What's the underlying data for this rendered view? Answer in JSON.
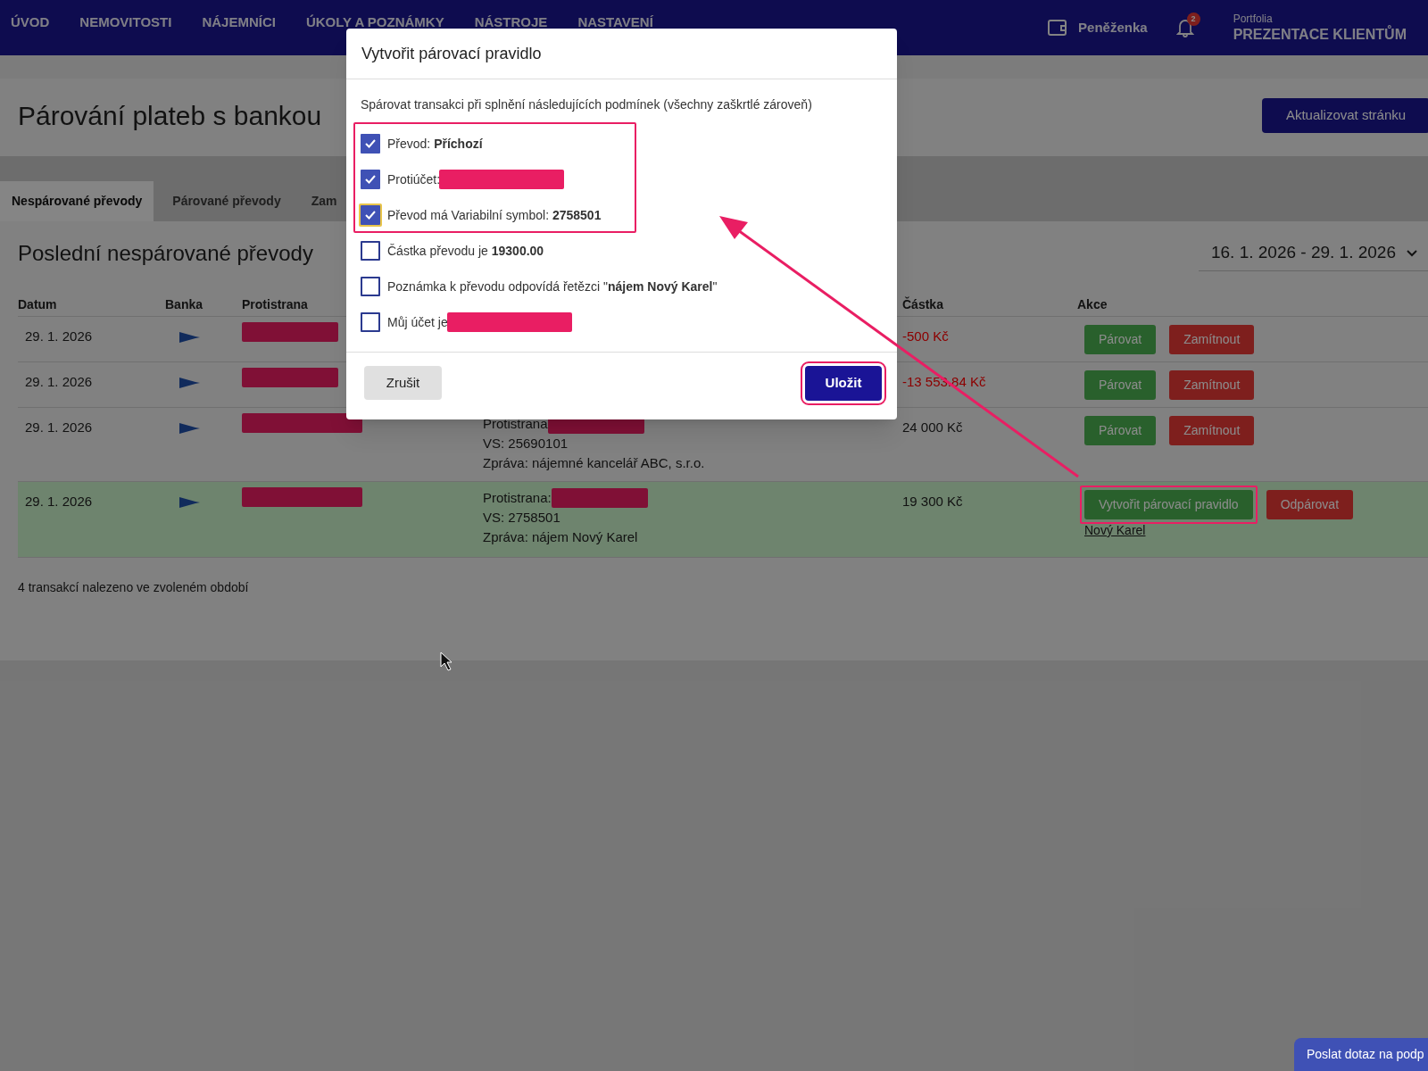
{
  "nav": {
    "items": [
      "ÚVOD",
      "NEMOVITOSTI",
      "NÁJEMNÍCI",
      "ÚKOLY A POZNÁMKY",
      "NÁSTROJE",
      "NASTAVENÍ"
    ],
    "wallet": "Peněženka",
    "notification_count": "2",
    "portfolio_label": "Portfolia",
    "portfolio_name": "PREZENTACE KLIENTŮM"
  },
  "page": {
    "title": "Párování plateb s bankou",
    "refresh_button": "Aktualizovat stránku"
  },
  "tabs": [
    {
      "label": "Nespárované převody",
      "selected": true
    },
    {
      "label": "Párované převody",
      "selected": false
    },
    {
      "label": "Zam",
      "selected": false
    }
  ],
  "section": {
    "title": "Poslední nespárované převody",
    "date_range": "16. 1. 2026 - 29. 1. 2026"
  },
  "table": {
    "columns": [
      "Datum",
      "Banka",
      "Protistrana",
      "Částka",
      "Akce"
    ],
    "rows": [
      {
        "date": "29. 1. 2026",
        "counterparty_redacted": true,
        "amount": "-500 Kč",
        "negative": true,
        "paired": false,
        "actions": [
          {
            "label": "Párovat",
            "kind": "pair"
          },
          {
            "label": "Zamítnout",
            "kind": "reject"
          }
        ]
      },
      {
        "date": "29. 1. 2026",
        "counterparty_redacted": true,
        "amount": "-13 553.84 Kč",
        "negative": true,
        "paired": false,
        "actions": [
          {
            "label": "Párovat",
            "kind": "pair"
          },
          {
            "label": "Zamítnout",
            "kind": "reject"
          }
        ]
      },
      {
        "date": "29. 1. 2026",
        "counterparty_redacted": true,
        "details": [
          {
            "text": "Protistrana",
            "redacted": true
          },
          {
            "text": "VS: 25690101",
            "redacted": false
          },
          {
            "text": "Zpráva: nájemné kancelář ABC, s.r.o.",
            "redacted": false
          }
        ],
        "amount": "24 000 Kč",
        "negative": false,
        "paired": false,
        "actions": [
          {
            "label": "Párovat",
            "kind": "pair"
          },
          {
            "label": "Zamítnout",
            "kind": "reject"
          }
        ]
      },
      {
        "date": "29. 1. 2026",
        "counterparty_redacted": true,
        "details": [
          {
            "text": "Protistrana:",
            "redacted": true
          },
          {
            "text": "VS: 2758501",
            "redacted": false
          },
          {
            "text": "Zpráva: nájem Nový Karel",
            "redacted": false
          }
        ],
        "amount": "19 300 Kč",
        "negative": false,
        "paired": true,
        "actions": [
          {
            "label": "Vytvořit párovací pravidlo",
            "kind": "pair",
            "highlighted": true
          },
          {
            "label": "Odpárovat",
            "kind": "reject"
          }
        ],
        "link": "Nový Karel"
      }
    ]
  },
  "summary": "4 transakcí nalezeno ve zvoleném období",
  "dialog": {
    "title": "Vytvořit párovací pravidlo",
    "intro": "Spárovat transakci při splnění následujících podmínek (všechny zaškrtlé zároveň)",
    "conditions": [
      {
        "text": "Převod: **Příchozí**",
        "checked": true,
        "redacted": false,
        "focused": false,
        "highlighted": true
      },
      {
        "text": "Protiúčet:",
        "checked": true,
        "redacted": true,
        "focused": false,
        "highlighted": true
      },
      {
        "text": "Převod má Variabilní symbol: **2758501**",
        "checked": true,
        "redacted": false,
        "focused": true,
        "highlighted": true
      },
      {
        "text": "Částka převodu je **19300.00**",
        "checked": false,
        "redacted": false,
        "focused": false,
        "highlighted": false
      },
      {
        "text": "Poznámka k převodu odpovídá řetězci \"**nájem Nový Karel**\"",
        "checked": false,
        "redacted": false,
        "focused": false,
        "highlighted": false
      },
      {
        "text": "Můj účet je",
        "checked": false,
        "redacted": true,
        "focused": false,
        "highlighted": false
      }
    ],
    "cancel": "Zrušit",
    "save": "Uložit",
    "save_highlighted": true
  },
  "help_button": "Poslat dotaz na podp"
}
